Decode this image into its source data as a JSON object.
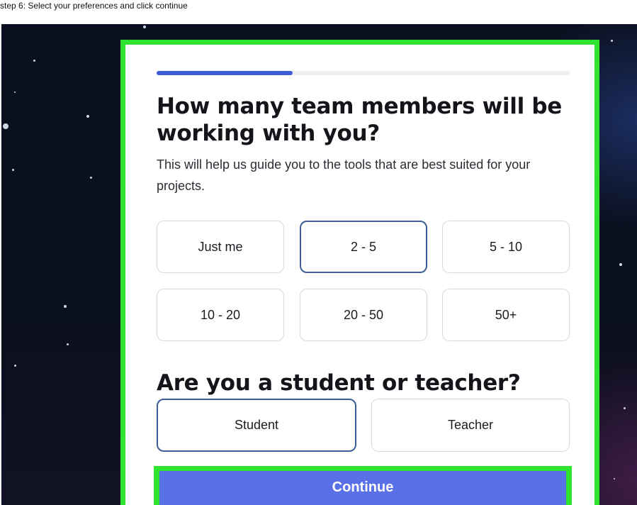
{
  "caption": "step 6: Select your preferences and click continue",
  "progress": {
    "fraction": 0.33
  },
  "team_question": {
    "title": "How many team members will be working with you?",
    "subtitle": "This will help us guide you to the tools that are best suited for your projects.",
    "options": [
      {
        "label": "Just me",
        "selected": false
      },
      {
        "label": "2 - 5",
        "selected": true
      },
      {
        "label": "5 - 10",
        "selected": false
      },
      {
        "label": "10 - 20",
        "selected": false
      },
      {
        "label": "20 - 50",
        "selected": false
      },
      {
        "label": "50+",
        "selected": false
      }
    ]
  },
  "role_question": {
    "title": "Are you a student or teacher?",
    "options": [
      {
        "label": "Student",
        "selected": true
      },
      {
        "label": "Teacher",
        "selected": false
      }
    ]
  },
  "continue_label": "Continue",
  "colors": {
    "highlight_green": "#2fe32f",
    "progress_blue": "#3f5bd6",
    "button_blue": "#5a70e6",
    "selected_border": "#3b5e98"
  }
}
